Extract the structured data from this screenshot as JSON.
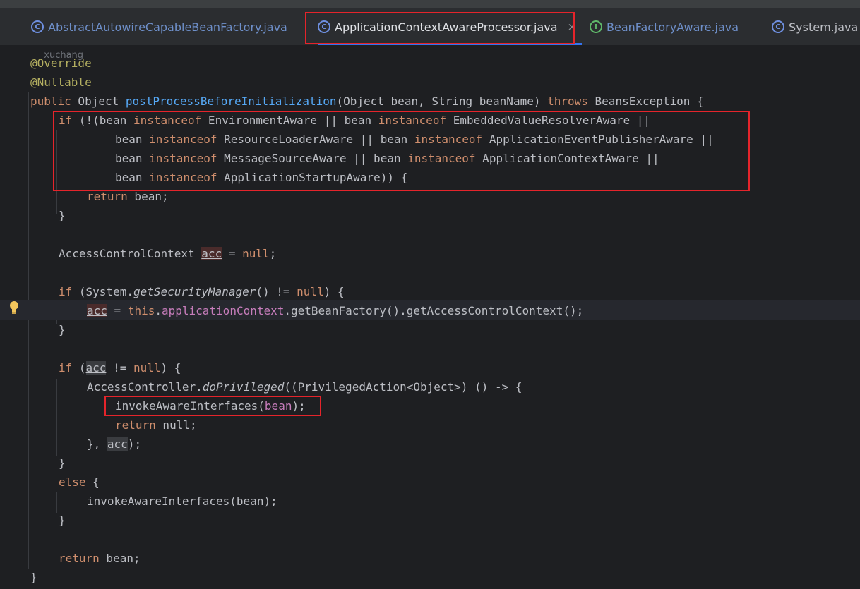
{
  "tabs": [
    {
      "label": "AbstractAutowireCapableBeanFactory.java",
      "icon": "class-icon"
    },
    {
      "label": "ApplicationContextAwareProcessor.java",
      "icon": "class-icon",
      "active": true,
      "close": "×"
    },
    {
      "label": "BeanFactoryAware.java",
      "icon": "interface-icon"
    },
    {
      "label": "System.java",
      "icon": "class-icon"
    }
  ],
  "author_hint": "xuchang",
  "code": {
    "l1": "@Override",
    "l2": "@Nullable",
    "l3_public": "public",
    "l3_object": " Object ",
    "l3_method": "postProcessBeforeInitialization",
    "l3_params": "(Object bean, String beanName) ",
    "l3_throws": "throws",
    "l3_end": " BeansException {",
    "l4_if": "if",
    "l4_a": " (!(bean ",
    "instanceof": "instanceof",
    "l4_b": " EnvironmentAware || bean ",
    "l4_c": " EmbeddedValueResolverAware ||",
    "bean_sp": "bean ",
    "l5_b": " ResourceLoaderAware || bean ",
    "l5_c": " ApplicationEventPublisherAware ||",
    "l6_b": " MessageSourceAware || bean ",
    "l6_c": " ApplicationContextAware ||",
    "l7_b": " ApplicationStartupAware)) {",
    "return": "return",
    "l8_rest": " bean;",
    "brace_close": "}",
    "l10_a": "AccessControlContext ",
    "acc": "acc",
    "l10_b": " = ",
    "null": "null",
    "semi": ";",
    "l12_a": " (System.",
    "l12_method": "getSecurityManager",
    "l12_b": "() != ",
    "l12_c": ") {",
    "this": "this",
    "l13_dot": ".",
    "l13_field": "applicationContext",
    "l13_rest": ".getBeanFactory().getAccessControlContext();",
    "l16_a": " (",
    "l16_b": " != ",
    "l16_c": ") {",
    "l17_a": "AccessController.",
    "l17_method": "doPrivileged",
    "l17_b": "((PrivilegedAction<Object>) () -> {",
    "l18_a": "invokeAwareInterfaces(",
    "bean": "bean",
    "l18_b": ");",
    "l19_rest": " null;",
    "l20_a": "}, ",
    "l20_b": ");",
    "else": "else",
    "l23_a": " {",
    "l24": "invokeAwareInterfaces(bean);",
    "l27_rest": " bean;"
  },
  "colors": {
    "keyword": "#cf8e6d",
    "annotation": "#b3ae60",
    "method": "#56a8f5",
    "field": "#c77dbb",
    "highlight_box": "#e5242b"
  }
}
